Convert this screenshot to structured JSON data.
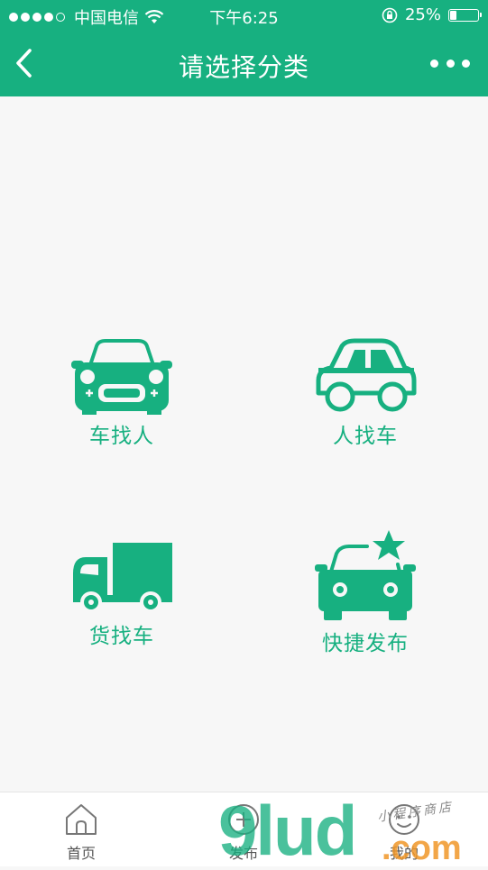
{
  "status_bar": {
    "carrier": "中国电信",
    "time": "下午6:25",
    "battery": "25%",
    "battery_level": 0.25,
    "signal_bars_filled": 4,
    "signal_bars_total": 5
  },
  "navbar": {
    "title": "请选择分类",
    "back_icon": "chevron-left-icon",
    "more_icon": "more-dots-icon"
  },
  "categories": [
    {
      "label": "车找人",
      "icon": "car-front-icon"
    },
    {
      "label": "人找车",
      "icon": "car-side-icon"
    },
    {
      "label": "货找车",
      "icon": "truck-icon"
    },
    {
      "label": "快捷发布",
      "icon": "car-star-icon"
    }
  ],
  "tabbar": {
    "items": [
      {
        "label": "首页",
        "icon": "home-icon"
      },
      {
        "label": "发布",
        "icon": "publish-icon"
      },
      {
        "label": "我的",
        "icon": "profile-icon"
      }
    ]
  },
  "watermark": {
    "main": "9lud",
    "domain": ".com",
    "note": "小程序商店"
  },
  "colors": {
    "brand": "#17b080",
    "background": "#f7f7f7",
    "tab_text": "#555555"
  }
}
